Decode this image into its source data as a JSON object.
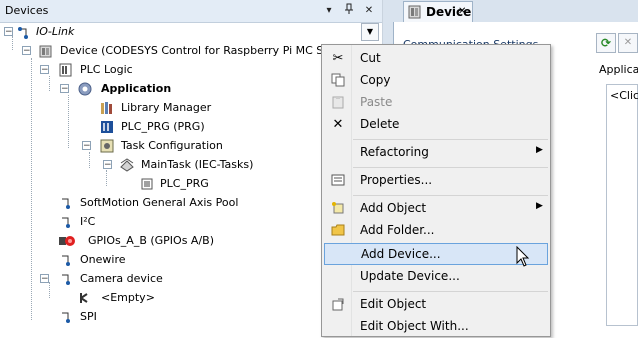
{
  "panel": {
    "title": "Devices",
    "pin_glyph": "▾",
    "dock_glyph": "ᵖ",
    "close_glyph": "✕"
  },
  "tree": {
    "root": "IO-Link",
    "device": "Device (CODESYS Control for Raspberry Pi MC SL)",
    "plc_logic": "PLC Logic",
    "application": "Application",
    "library_manager": "Library Manager",
    "plc_prg": "PLC_PRG (PRG)",
    "task_configuration": "Task Configuration",
    "main_task": "MainTask (IEC-Tasks)",
    "main_task_prg": "PLC_PRG",
    "softmotion": "SoftMotion General Axis Pool",
    "i2c": "I²C",
    "gpios": "GPIOs_A_B (GPIOs A/B)",
    "onewire": "Onewire",
    "camera": "Camera device",
    "empty": "<Empty>",
    "spi": "SPI"
  },
  "editor": {
    "tab_label": "Device",
    "comm_settings": "Communication Settings",
    "applic_label": "Applica",
    "click_text": "<Click"
  },
  "menu": {
    "cut": "Cut",
    "copy": "Copy",
    "paste": "Paste",
    "delete": "Delete",
    "refactoring": "Refactoring",
    "properties": "Properties...",
    "add_object": "Add Object",
    "add_folder": "Add Folder...",
    "add_device": "Add Device...",
    "update_device": "Update Device...",
    "edit_object": "Edit Object",
    "edit_object_with": "Edit Object With..."
  },
  "colors": {
    "highlight": "#d8e6f7",
    "accent": "#6aa3dd"
  }
}
